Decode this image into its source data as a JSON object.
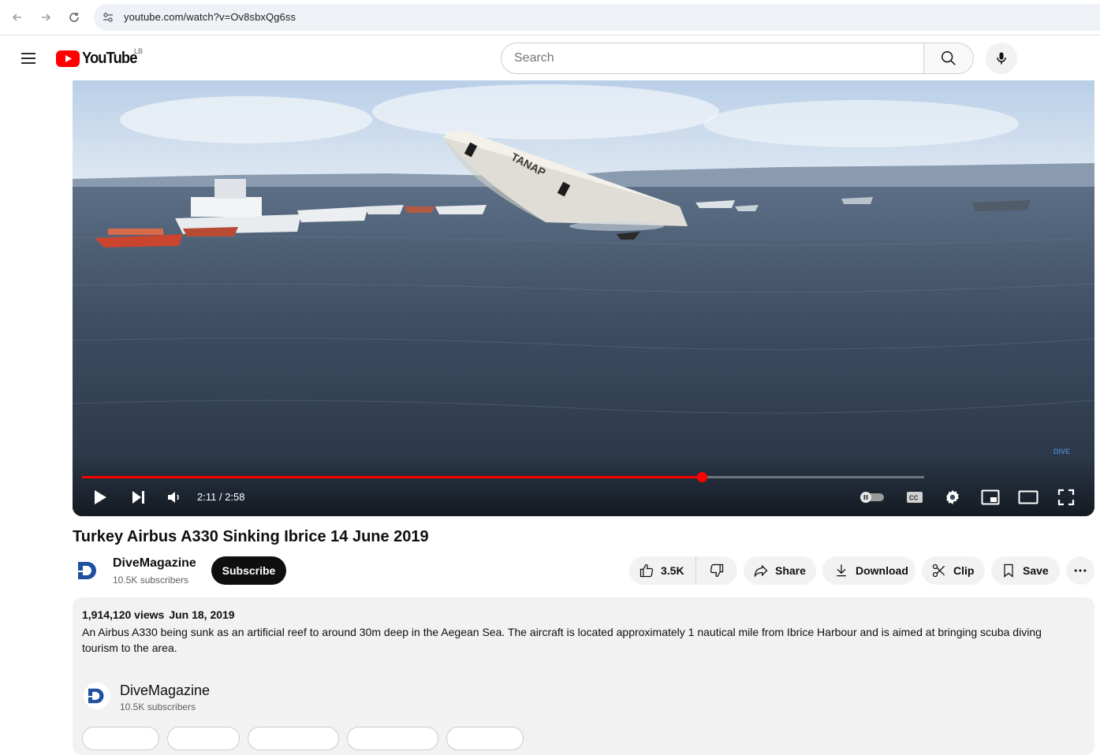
{
  "browser": {
    "url": "youtube.com/watch?v=Ov8sbxQg6ss"
  },
  "header": {
    "logo_text": "YouTube",
    "country_code": "LB",
    "search_placeholder": "Search"
  },
  "player": {
    "time_current": "2:11",
    "time_separator": " / ",
    "time_total": "2:58",
    "progress_fraction": 0.736,
    "buffered_fraction": 1.0,
    "watermark": "DIVE",
    "plane_livery": "TANAP"
  },
  "video": {
    "title": "Turkey Airbus A330 Sinking Ibrice 14 June 2019"
  },
  "channel": {
    "name": "DiveMagazine",
    "subscribers": "10.5K subscribers",
    "avatar_letter": "D",
    "subscribe_label": "Subscribe"
  },
  "actions": {
    "likes": "3.5K",
    "share_label": "Share",
    "download_label": "Download",
    "clip_label": "Clip",
    "save_label": "Save"
  },
  "description": {
    "views": "1,914,120 views",
    "date": "Jun 18, 2019",
    "text": "An Airbus A330 being sunk as an artificial reef to around 30m deep in the Aegean Sea. The aircraft is located approximately 1 nautical mile from Ibrice Harbour and is aimed at bringing scuba diving tourism to the area.",
    "channel_name": "DiveMagazine",
    "channel_subscribers": "10.5K subscribers"
  },
  "colors": {
    "accent_red": "#ff0000",
    "brand_blue": "#1e4fa0"
  }
}
